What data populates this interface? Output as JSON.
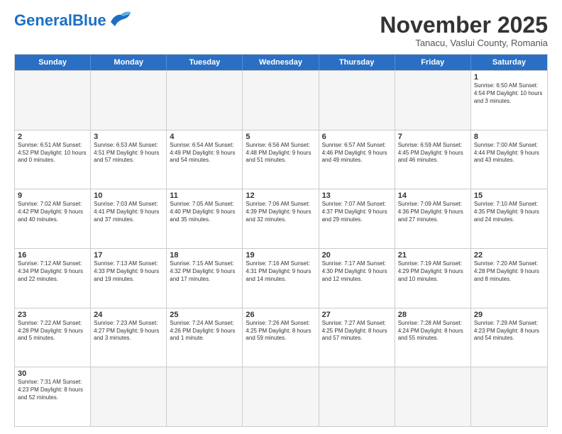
{
  "logo": {
    "text_general": "General",
    "text_blue": "Blue"
  },
  "header": {
    "month_title": "November 2025",
    "subtitle": "Tanacu, Vaslui County, Romania"
  },
  "day_headers": [
    "Sunday",
    "Monday",
    "Tuesday",
    "Wednesday",
    "Thursday",
    "Friday",
    "Saturday"
  ],
  "weeks": [
    [
      {
        "day": "",
        "empty": true
      },
      {
        "day": "",
        "empty": true
      },
      {
        "day": "",
        "empty": true
      },
      {
        "day": "",
        "empty": true
      },
      {
        "day": "",
        "empty": true
      },
      {
        "day": "",
        "empty": true
      },
      {
        "day": "1",
        "info": "Sunrise: 6:50 AM\nSunset: 4:54 PM\nDaylight: 10 hours\nand 3 minutes."
      }
    ],
    [
      {
        "day": "2",
        "info": "Sunrise: 6:51 AM\nSunset: 4:52 PM\nDaylight: 10 hours\nand 0 minutes."
      },
      {
        "day": "3",
        "info": "Sunrise: 6:53 AM\nSunset: 4:51 PM\nDaylight: 9 hours\nand 57 minutes."
      },
      {
        "day": "4",
        "info": "Sunrise: 6:54 AM\nSunset: 4:49 PM\nDaylight: 9 hours\nand 54 minutes."
      },
      {
        "day": "5",
        "info": "Sunrise: 6:56 AM\nSunset: 4:48 PM\nDaylight: 9 hours\nand 51 minutes."
      },
      {
        "day": "6",
        "info": "Sunrise: 6:57 AM\nSunset: 4:46 PM\nDaylight: 9 hours\nand 49 minutes."
      },
      {
        "day": "7",
        "info": "Sunrise: 6:59 AM\nSunset: 4:45 PM\nDaylight: 9 hours\nand 46 minutes."
      },
      {
        "day": "8",
        "info": "Sunrise: 7:00 AM\nSunset: 4:44 PM\nDaylight: 9 hours\nand 43 minutes."
      }
    ],
    [
      {
        "day": "9",
        "info": "Sunrise: 7:02 AM\nSunset: 4:42 PM\nDaylight: 9 hours\nand 40 minutes."
      },
      {
        "day": "10",
        "info": "Sunrise: 7:03 AM\nSunset: 4:41 PM\nDaylight: 9 hours\nand 37 minutes."
      },
      {
        "day": "11",
        "info": "Sunrise: 7:05 AM\nSunset: 4:40 PM\nDaylight: 9 hours\nand 35 minutes."
      },
      {
        "day": "12",
        "info": "Sunrise: 7:06 AM\nSunset: 4:39 PM\nDaylight: 9 hours\nand 32 minutes."
      },
      {
        "day": "13",
        "info": "Sunrise: 7:07 AM\nSunset: 4:37 PM\nDaylight: 9 hours\nand 29 minutes."
      },
      {
        "day": "14",
        "info": "Sunrise: 7:09 AM\nSunset: 4:36 PM\nDaylight: 9 hours\nand 27 minutes."
      },
      {
        "day": "15",
        "info": "Sunrise: 7:10 AM\nSunset: 4:35 PM\nDaylight: 9 hours\nand 24 minutes."
      }
    ],
    [
      {
        "day": "16",
        "info": "Sunrise: 7:12 AM\nSunset: 4:34 PM\nDaylight: 9 hours\nand 22 minutes."
      },
      {
        "day": "17",
        "info": "Sunrise: 7:13 AM\nSunset: 4:33 PM\nDaylight: 9 hours\nand 19 minutes."
      },
      {
        "day": "18",
        "info": "Sunrise: 7:15 AM\nSunset: 4:32 PM\nDaylight: 9 hours\nand 17 minutes."
      },
      {
        "day": "19",
        "info": "Sunrise: 7:16 AM\nSunset: 4:31 PM\nDaylight: 9 hours\nand 14 minutes."
      },
      {
        "day": "20",
        "info": "Sunrise: 7:17 AM\nSunset: 4:30 PM\nDaylight: 9 hours\nand 12 minutes."
      },
      {
        "day": "21",
        "info": "Sunrise: 7:19 AM\nSunset: 4:29 PM\nDaylight: 9 hours\nand 10 minutes."
      },
      {
        "day": "22",
        "info": "Sunrise: 7:20 AM\nSunset: 4:28 PM\nDaylight: 9 hours\nand 8 minutes."
      }
    ],
    [
      {
        "day": "23",
        "info": "Sunrise: 7:22 AM\nSunset: 4:28 PM\nDaylight: 9 hours\nand 5 minutes."
      },
      {
        "day": "24",
        "info": "Sunrise: 7:23 AM\nSunset: 4:27 PM\nDaylight: 9 hours\nand 3 minutes."
      },
      {
        "day": "25",
        "info": "Sunrise: 7:24 AM\nSunset: 4:26 PM\nDaylight: 9 hours\nand 1 minute."
      },
      {
        "day": "26",
        "info": "Sunrise: 7:26 AM\nSunset: 4:25 PM\nDaylight: 8 hours\nand 59 minutes."
      },
      {
        "day": "27",
        "info": "Sunrise: 7:27 AM\nSunset: 4:25 PM\nDaylight: 8 hours\nand 57 minutes."
      },
      {
        "day": "28",
        "info": "Sunrise: 7:28 AM\nSunset: 4:24 PM\nDaylight: 8 hours\nand 55 minutes."
      },
      {
        "day": "29",
        "info": "Sunrise: 7:29 AM\nSunset: 4:23 PM\nDaylight: 8 hours\nand 54 minutes."
      }
    ],
    [
      {
        "day": "30",
        "info": "Sunrise: 7:31 AM\nSunset: 4:23 PM\nDaylight: 8 hours\nand 52 minutes."
      },
      {
        "day": "",
        "empty": true
      },
      {
        "day": "",
        "empty": true
      },
      {
        "day": "",
        "empty": true
      },
      {
        "day": "",
        "empty": true
      },
      {
        "day": "",
        "empty": true
      },
      {
        "day": "",
        "empty": true
      }
    ]
  ]
}
